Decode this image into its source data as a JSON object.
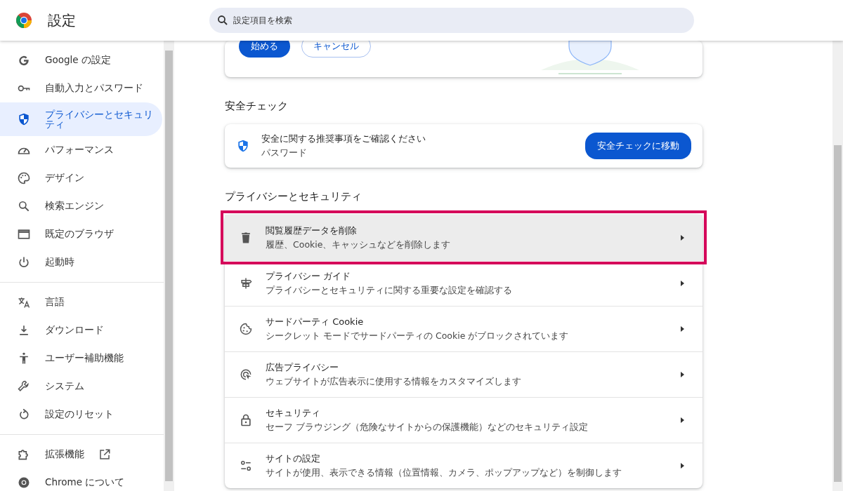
{
  "header": {
    "title": "設定",
    "search": {
      "placeholder": "設定項目を検索"
    }
  },
  "sidebar": {
    "groups": [
      [
        {
          "label": "Google の設定",
          "selected": false
        },
        {
          "label": "自動入力とパスワード",
          "selected": false
        },
        {
          "label": "プライバシーとセキュリティ",
          "selected": true
        },
        {
          "label": "パフォーマンス",
          "selected": false
        },
        {
          "label": "デザイン",
          "selected": false
        },
        {
          "label": "検索エンジン",
          "selected": false
        },
        {
          "label": "既定のブラウザ",
          "selected": false
        },
        {
          "label": "起動時",
          "selected": false
        }
      ],
      [
        {
          "label": "言語",
          "selected": false
        },
        {
          "label": "ダウンロード",
          "selected": false
        },
        {
          "label": "ユーザー補助機能",
          "selected": false
        },
        {
          "label": "システム",
          "selected": false
        },
        {
          "label": "設定のリセット",
          "selected": false
        }
      ],
      [
        {
          "label": "拡張機能",
          "selected": false,
          "external": true
        },
        {
          "label": "Chrome について",
          "selected": false,
          "external": false
        }
      ]
    ]
  },
  "top_card": {
    "buttons": [
      {
        "label": "始める",
        "kind": "primary"
      },
      {
        "label": "キャンセル",
        "kind": "outline"
      }
    ]
  },
  "safety_check": {
    "heading": "安全チェック",
    "title": "安全に関する推奨事項をご確認ください",
    "subtitle": "パスワード",
    "button": "安全チェックに移動"
  },
  "privacy": {
    "heading": "プライバシーとセキュリティ",
    "rows": [
      {
        "title": "閲覧履歴データを削除",
        "subtitle": "履歴、Cookie、キャッシュなどを削除します",
        "highlighted": true
      },
      {
        "title": "プライバシー ガイド",
        "subtitle": "プライバシーとセキュリティに関する重要な設定を確認する",
        "highlighted": false
      },
      {
        "title": "サードパーティ Cookie",
        "subtitle": "シークレット モードでサードパーティの Cookie がブロックされています",
        "highlighted": false
      },
      {
        "title": "広告プライバシー",
        "subtitle": "ウェブサイトが広告表示に使用する情報をカスタマイズします",
        "highlighted": false
      },
      {
        "title": "セキュリティ",
        "subtitle": "セーフ ブラウジング（危険なサイトからの保護機能）などのセキュリティ設定",
        "highlighted": false
      },
      {
        "title": "サイトの設定",
        "subtitle": "サイトが使用、表示できる情報（位置情報、カメラ、ポップアップなど）を制御します",
        "highlighted": false
      }
    ]
  }
}
